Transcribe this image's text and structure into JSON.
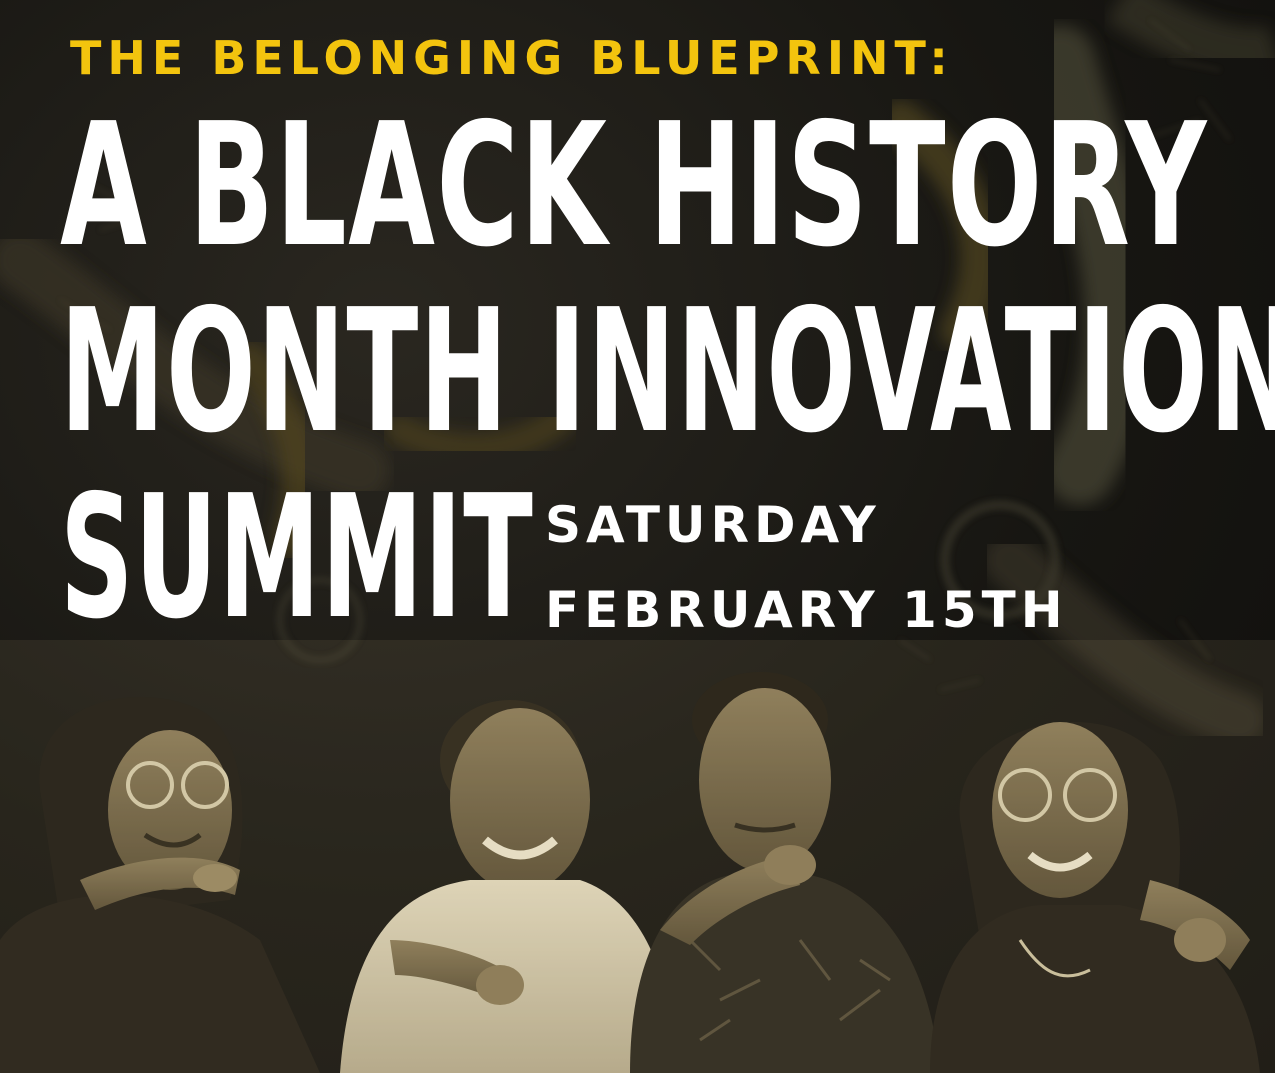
{
  "kicker": "THE BELONGING BLUEPRINT:",
  "headline": {
    "line1": "A BLACK HISTORY",
    "line2": "MONTH INNOVATION",
    "line3": "SUMMIT"
  },
  "date": {
    "day": "SATURDAY",
    "full": "FEBRUARY 15TH"
  },
  "colors": {
    "accent": "#f3c40e",
    "headline": "#ffffff",
    "background": "#151411",
    "photo_tone": "#c9bb92"
  }
}
